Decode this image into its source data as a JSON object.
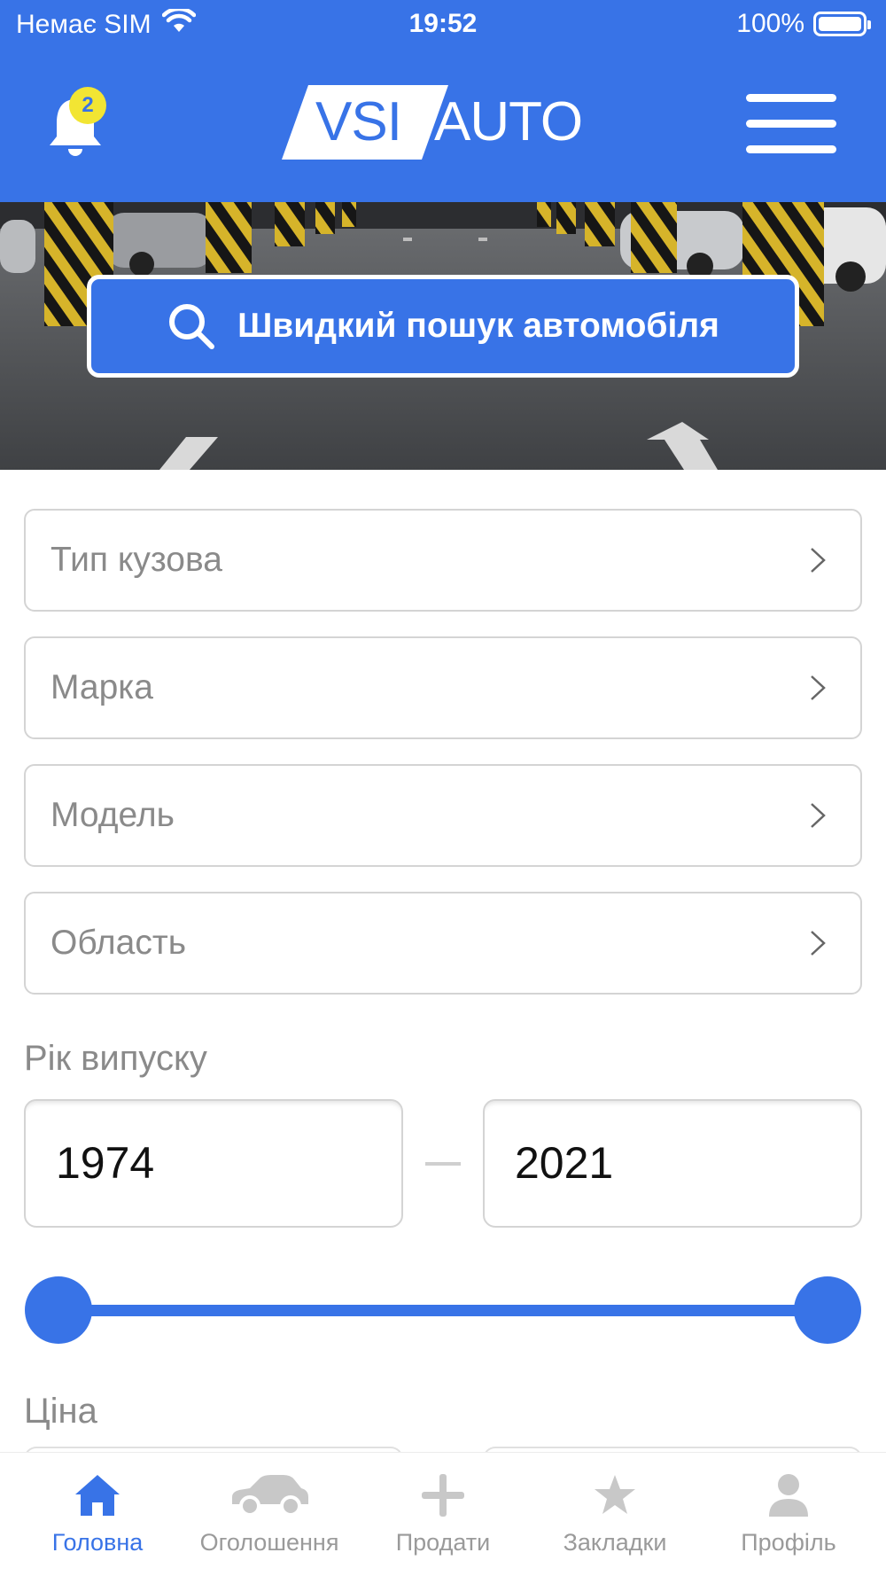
{
  "status_bar": {
    "carrier": "Немає SIM",
    "time": "19:52",
    "battery": "100%"
  },
  "header": {
    "notification_count": "2",
    "logo_part1": "VSI",
    "logo_part2": "AUTO"
  },
  "hero": {
    "quick_search_label": "Швидкий пошук автомобіля"
  },
  "filters": [
    {
      "label": "Тип кузова"
    },
    {
      "label": "Марка"
    },
    {
      "label": "Модель"
    },
    {
      "label": "Область"
    }
  ],
  "year": {
    "label": "Рік випуску",
    "from": "1974",
    "to": "2021",
    "slider_min_fraction": 0.0,
    "slider_max_fraction": 1.0
  },
  "price": {
    "label": "Ціна"
  },
  "tabbar": {
    "tabs": [
      {
        "label": "Головна",
        "icon": "home-icon",
        "active": true
      },
      {
        "label": "Оголошення",
        "icon": "car-icon",
        "active": false
      },
      {
        "label": "Продати",
        "icon": "plus-icon",
        "active": false
      },
      {
        "label": "Закладки",
        "icon": "star-icon",
        "active": false
      },
      {
        "label": "Профіль",
        "icon": "profile-icon",
        "active": false
      }
    ]
  },
  "colors": {
    "primary": "#3873E7",
    "badge": "#F2E533",
    "inactive": "#9A9A9A",
    "placeholder": "#8A8A8A",
    "border": "#D4D4D4"
  }
}
